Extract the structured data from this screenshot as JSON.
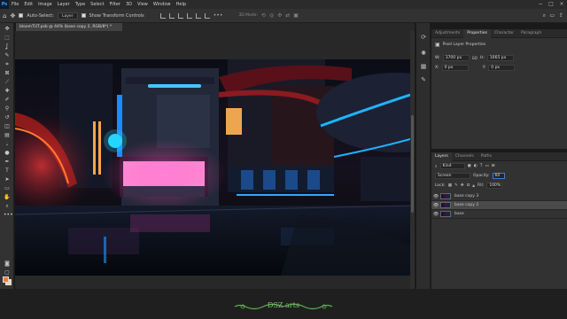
{
  "menubar": {
    "app_logo": "Ps",
    "items": [
      "File",
      "Edit",
      "Image",
      "Layer",
      "Type",
      "Select",
      "Filter",
      "3D",
      "View",
      "Window",
      "Help"
    ],
    "window_controls": [
      "−",
      "□",
      "×"
    ]
  },
  "options": {
    "auto_select_label": "Auto-Select:",
    "auto_select_value": "Layer",
    "transform_label": "Show Transform Controls",
    "mode_3d": "3D Mode:"
  },
  "document": {
    "tab_title": "bloomTUT.psb @ 44% (base copy 2, RGB/8*) *"
  },
  "properties": {
    "tabs": [
      "Adjustments",
      "Properties",
      "Character",
      "Paragraph"
    ],
    "active_tab": "Properties",
    "layer_type": "Pixel Layer Properties",
    "w_label": "W:",
    "w_value": "3700 px",
    "link_icon": "GO",
    "h_label": "H:",
    "h_value": "1665 px",
    "x_label": "X:",
    "x_value": "0 px",
    "y_label": "Y:",
    "y_value": "0 px"
  },
  "layers": {
    "tabs": [
      "Layers",
      "Channels",
      "Paths"
    ],
    "active_tab": "Layers",
    "kind_label": "Kind",
    "blend_mode": "Screen",
    "opacity_label": "Opacity:",
    "opacity_value": "60",
    "lock_label": "Lock:",
    "fill_label": "Fill:",
    "fill_value": "100%",
    "items": [
      {
        "name": "base copy 3",
        "selected": false
      },
      {
        "name": "base copy 2",
        "selected": true
      },
      {
        "name": "base",
        "selected": false
      }
    ]
  },
  "footer": {
    "credit": "DSZ arts"
  },
  "colors": {
    "foreground": "#e8832f",
    "background": "#f0d6a8",
    "credit_green": "#7cc36a",
    "neon_blue": "#1e9bff",
    "neon_pink": "#ff4fa8"
  }
}
